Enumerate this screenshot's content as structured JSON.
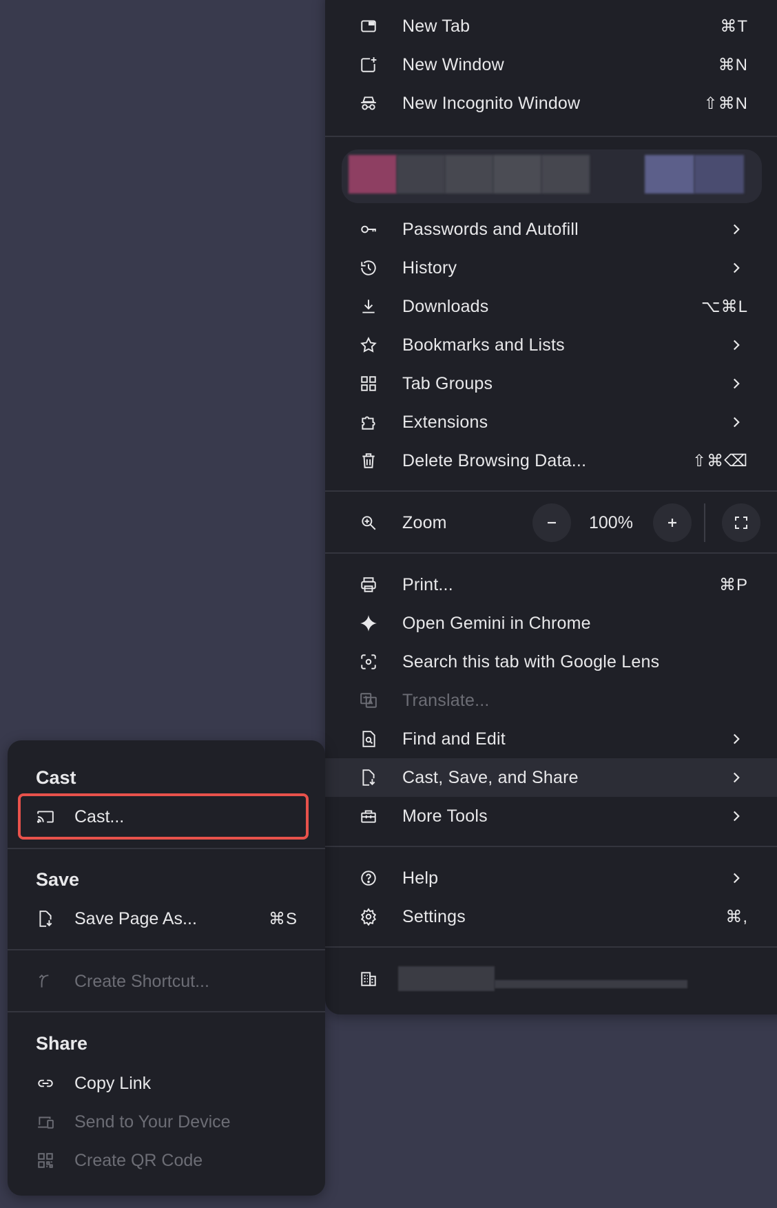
{
  "menu": {
    "items_top": [
      {
        "label": "New Tab",
        "shortcut": "⌘T",
        "icon": "new-tab-icon"
      },
      {
        "label": "New Window",
        "shortcut": "⌘N",
        "icon": "new-window-icon"
      },
      {
        "label": "New Incognito Window",
        "shortcut": "⇧⌘N",
        "icon": "incognito-icon"
      }
    ],
    "items_mid": [
      {
        "label": "Passwords and Autofill",
        "icon": "key-icon",
        "submenu": true
      },
      {
        "label": "History",
        "icon": "history-icon",
        "submenu": true
      },
      {
        "label": "Downloads",
        "shortcut": "⌥⌘L",
        "icon": "download-icon"
      },
      {
        "label": "Bookmarks and Lists",
        "icon": "star-icon",
        "submenu": true
      },
      {
        "label": "Tab Groups",
        "icon": "grid-icon",
        "submenu": true
      },
      {
        "label": "Extensions",
        "icon": "puzzle-icon",
        "submenu": true
      },
      {
        "label": "Delete Browsing Data...",
        "shortcut": "⇧⌘⌫",
        "icon": "trash-icon"
      }
    ],
    "zoom": {
      "label": "Zoom",
      "value": "100%",
      "minus": "−",
      "plus": "+"
    },
    "items_tools": [
      {
        "label": "Print...",
        "shortcut": "⌘P",
        "icon": "print-icon"
      },
      {
        "label": "Open Gemini in Chrome",
        "icon": "sparkle-icon"
      },
      {
        "label": "Search this tab with Google Lens",
        "icon": "lens-icon"
      },
      {
        "label": "Translate...",
        "icon": "translate-icon",
        "disabled": true
      },
      {
        "label": "Find and Edit",
        "icon": "find-icon",
        "submenu": true
      },
      {
        "label": "Cast, Save, and Share",
        "icon": "cast-save-icon",
        "submenu": true,
        "highlighted": true
      },
      {
        "label": "More Tools",
        "icon": "toolbox-icon",
        "submenu": true
      }
    ],
    "items_bottom": [
      {
        "label": "Help",
        "icon": "help-icon",
        "submenu": true
      },
      {
        "label": "Settings",
        "shortcut": "⌘,",
        "icon": "gear-icon"
      }
    ]
  },
  "submenu": {
    "cast_title": "Cast",
    "cast_item": "Cast...",
    "save_title": "Save",
    "save_item": "Save Page As...",
    "save_shortcut": "⌘S",
    "shortcut_item": "Create Shortcut...",
    "share_title": "Share",
    "copy_link": "Copy Link",
    "send_device": "Send to Your Device",
    "qr_code": "Create QR Code"
  },
  "colors": {
    "background": "#393a4d",
    "menu_bg": "#1f2027",
    "highlight_border": "#e8524b",
    "text": "#e8e8ea",
    "disabled_text": "#6c6d75"
  }
}
